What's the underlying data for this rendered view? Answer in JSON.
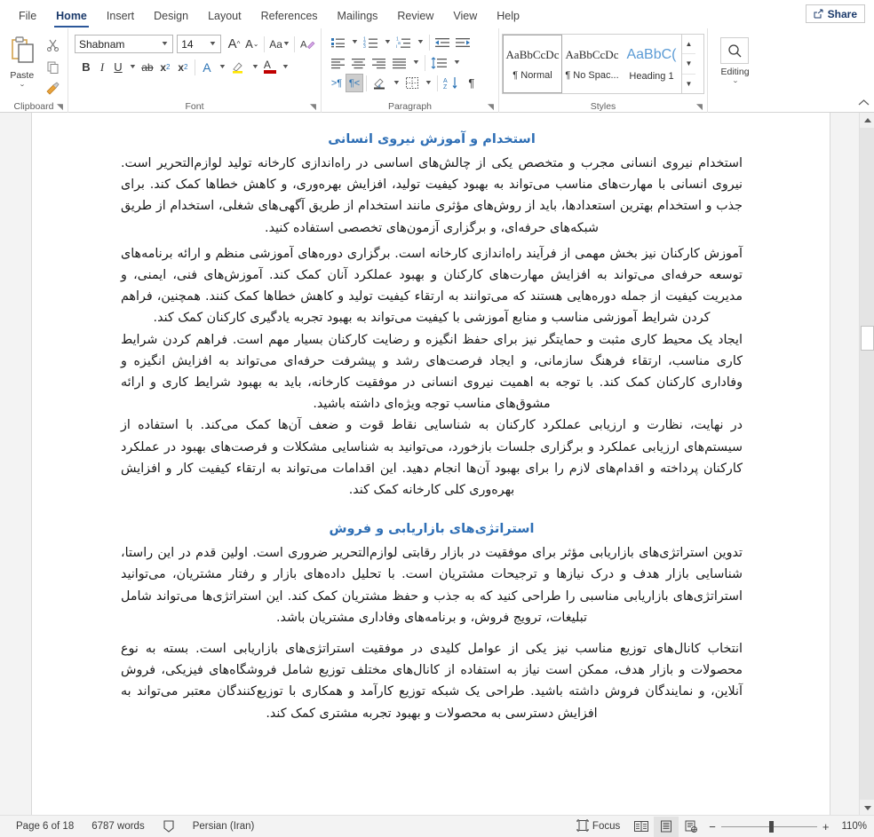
{
  "app": {
    "accent": "#2b579a",
    "heading_color": "#2f6fb5"
  },
  "tabs": [
    {
      "label": "File",
      "active": false
    },
    {
      "label": "Home",
      "active": true
    },
    {
      "label": "Insert",
      "active": false
    },
    {
      "label": "Design",
      "active": false
    },
    {
      "label": "Layout",
      "active": false
    },
    {
      "label": "References",
      "active": false
    },
    {
      "label": "Mailings",
      "active": false
    },
    {
      "label": "Review",
      "active": false
    },
    {
      "label": "View",
      "active": false
    },
    {
      "label": "Help",
      "active": false
    }
  ],
  "share": {
    "label": "Share",
    "icon": "share-icon"
  },
  "ribbon": {
    "clipboard": {
      "label": "Clipboard",
      "paste_label": "Paste",
      "paste_caret": "⌄",
      "cut_icon": "scissors-icon",
      "copy_icon": "copy-icon",
      "format_painter_icon": "format-painter-icon",
      "dialog_launcher": "◥"
    },
    "font": {
      "label": "Font",
      "font_name": "Shabnam",
      "font_size": "14",
      "grow_font": "A",
      "shrink_font": "A",
      "change_case": "Aa",
      "clear_formatting_icon": "clear-formatting-icon",
      "bold": "B",
      "italic": "I",
      "underline": "U",
      "strikethrough": "ab",
      "subscript": "x",
      "subscript_sup": "2",
      "superscript": "x",
      "superscript_sup": "2",
      "text_effects": "A",
      "highlight": "highlight-icon",
      "font_color": "A",
      "dialog_launcher": "◥"
    },
    "paragraph": {
      "label": "Paragraph",
      "bullets_icon": "bullets-icon",
      "numbering_icon": "numbering-icon",
      "multilevel_icon": "multilevel-list-icon",
      "decrease_indent_icon": "decrease-indent-icon",
      "increase_indent_icon": "increase-indent-icon",
      "align_left_icon": "align-left-icon",
      "align_center_icon": "align-center-icon",
      "align_right_icon": "align-right-icon",
      "justify_icon": "justify-icon",
      "line_spacing_icon": "line-spacing-icon",
      "ltr_icon": "ltr-text-direction-icon",
      "rtl_icon": "rtl-text-direction-icon",
      "shading_icon": "shading-icon",
      "borders_icon": "borders-icon",
      "sort_icon": "sort-icon",
      "show_marks_icon": "show-formatting-marks-icon",
      "dialog_launcher": "◥"
    },
    "styles": {
      "label": "Styles",
      "dialog_launcher": "◥",
      "items": [
        {
          "sample": "AaBbCcDc",
          "name": "¶ Normal",
          "selected": true,
          "heading": false
        },
        {
          "sample": "AaBbCcDc",
          "name": "¶ No Spac...",
          "selected": false,
          "heading": false
        },
        {
          "sample": "AaBbC(",
          "name": "Heading 1",
          "selected": false,
          "heading": true
        }
      ],
      "scroll_up": "▲",
      "scroll_down": "▼",
      "scroll_more": "▼"
    },
    "editing": {
      "label": "Editing",
      "search_icon": "magnifier-icon",
      "caret": "⌄"
    },
    "collapse_icon": "collapse-ribbon-chevron-icon"
  },
  "document": {
    "blocks": [
      {
        "type": "heading",
        "text": "استخدام و آموزش نیروی انسانی"
      },
      {
        "type": "para",
        "text": "استخدام نیروی انسانی مجرب و متخصص یکی از چالش‌های اساسی در راه‌اندازی کارخانه تولید لوازم‌التحریر است. نیروی انسانی با مهارت‌های مناسب می‌تواند به بهبود کیفیت تولید، افزایش بهره‌وری، و کاهش خطاها کمک کند. برای جذب و استخدام بهترین استعدادها، باید از روش‌های مؤثری مانند استخدام از طریق آگهی‌های شغلی، استخدام از طریق شبکه‌های حرفه‌ای، و برگزاری آزمون‌های تخصصی استفاده کنید."
      },
      {
        "type": "para",
        "text": "آموزش کارکنان نیز بخش مهمی از فرآیند راه‌اندازی کارخانه است. برگزاری دوره‌های آموزشی منظم و ارائه برنامه‌های توسعه حرفه‌ای می‌تواند به افزایش مهارت‌های کارکنان و بهبود عملکرد آنان کمک کند. آموزش‌های فنی، ایمنی، و مدیریت کیفیت از جمله دوره‌هایی هستند که می‌توانند به ارتقاء کیفیت تولید و کاهش خطاها کمک کنند. همچنین، فراهم کردن شرایط آموزشی مناسب و منابع آموزشی با کیفیت می‌تواند به بهبود تجربه یادگیری کارکنان کمک کند."
      },
      {
        "type": "para",
        "text": "ایجاد یک محیط کاری مثبت و حمایتگر نیز برای حفظ انگیزه و رضایت کارکنان بسیار مهم است. فراهم کردن شرایط کاری مناسب، ارتقاء فرهنگ سازمانی، و ایجاد فرصت‌های رشد و پیشرفت حرفه‌ای می‌تواند به افزایش انگیزه و وفاداری کارکنان کمک کند. با توجه به اهمیت نیروی انسانی در موفقیت کارخانه، باید به بهبود شرایط کاری و ارائه مشوق‌های مناسب توجه ویژه‌ای داشته باشید."
      },
      {
        "type": "para",
        "text": "در نهایت، نظارت و ارزیابی عملکرد کارکنان به شناسایی نقاط قوت و ضعف آن‌ها کمک می‌کند. با استفاده از سیستم‌های ارزیابی عملکرد و برگزاری جلسات بازخورد، می‌توانید به شناسایی مشکلات و فرصت‌های بهبود در عملکرد کارکنان پرداخته و اقدام‌های لازم را برای بهبود آن‌ها انجام دهید. این اقدامات می‌تواند به ارتقاء کیفیت کار و افزایش بهره‌وری کلی کارخانه کمک کند."
      },
      {
        "type": "heading",
        "text": "استراتژی‌های بازاریابی و فروش"
      },
      {
        "type": "para",
        "text": "تدوین استراتژی‌های بازاریابی مؤثر برای موفقیت در بازار رقابتی لوازم‌التحریر ضروری است. اولین قدم در این راستا، شناسایی بازار هدف و درک نیازها و ترجیحات مشتریان است. با تحلیل داده‌های بازار و رفتار مشتریان، می‌توانید استراتژی‌های بازاریابی مناسبی را طراحی کنید که به جذب و حفظ مشتریان کمک کند. این استراتژی‌ها می‌تواند شامل تبلیغات، ترویج فروش، و برنامه‌های وفاداری مشتریان باشد."
      },
      {
        "type": "para",
        "text": "انتخاب کانال‌های توزیع مناسب نیز یکی از عوامل کلیدی در موفقیت استراتژی‌های بازاریابی است. بسته به نوع محصولات و بازار هدف، ممکن است نیاز به استفاده از کانال‌های مختلف توزیع شامل فروشگاه‌های فیزیکی، فروش آنلاین، و نمایندگان فروش داشته باشید. طراحی یک شبکه توزیع کارآمد و همکاری با توزیع‌کنندگان معتبر می‌تواند به افزایش دسترسی به محصولات و بهبود تجربه مشتری کمک کند."
      }
    ]
  },
  "scrollbar": {
    "up_arrow": "▲",
    "down_arrow": "▼"
  },
  "status": {
    "page": "Page 6 of 18",
    "words": "6787 words",
    "proofing_icon": "proofing-errors-icon",
    "language": "Persian (Iran)",
    "focus_label": "Focus",
    "focus_icon": "focus-mode-icon",
    "view_read_icon": "read-mode-icon",
    "view_print_icon": "print-layout-icon",
    "view_web_icon": "web-layout-icon",
    "zoom_out": "−",
    "zoom_in": "+",
    "zoom_level": "110%"
  }
}
